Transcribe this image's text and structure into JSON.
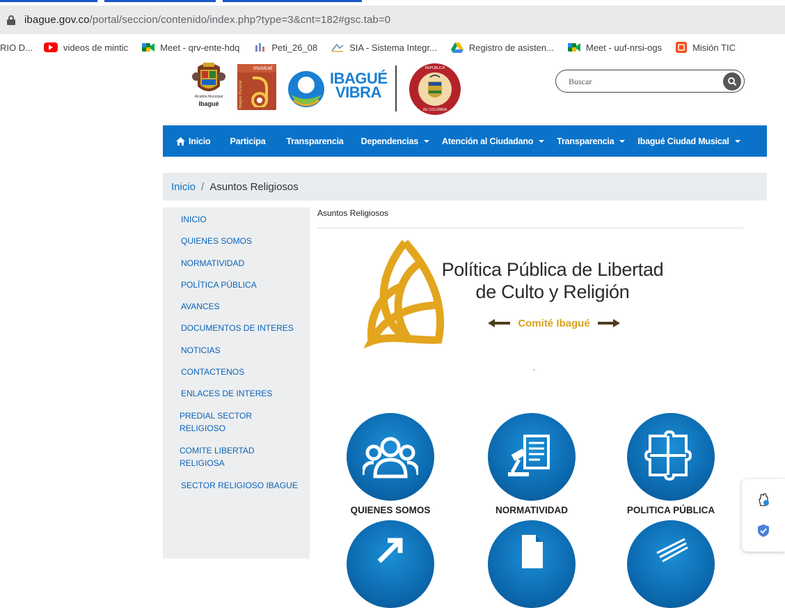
{
  "browser": {
    "url_domain": "ibague.gov.co",
    "url_path": "/portal/seccion/contenido/index.php?type=3&cnt=182#gsc.tab=0",
    "bookmarks": [
      {
        "label": "RIO D...",
        "icon": "none",
        "color": ""
      },
      {
        "label": "videos de mintic",
        "icon": "youtube-icon",
        "color": "#ff0000"
      },
      {
        "label": "Meet - qrv-ente-hdq",
        "icon": "meet-icon",
        "color": "#00832d"
      },
      {
        "label": "Peti_26_08",
        "icon": "doc-icon",
        "color": "#8e7cc3"
      },
      {
        "label": "SIA - Sistema Integr...",
        "icon": "sia-icon",
        "color": "#7aa0c4"
      },
      {
        "label": "Registro de asisten...",
        "icon": "drive-icon",
        "color": "#fbbc04"
      },
      {
        "label": "Meet - uuf-nrsi-ogs",
        "icon": "meet-icon",
        "color": "#00832d"
      },
      {
        "label": "Misión TIC",
        "icon": "mision-icon",
        "color": "#f4511e"
      }
    ]
  },
  "header": {
    "logo1_text1": "Alcaldía Municipal",
    "logo1_text2": "Ibagué",
    "logo2_text1": "musical",
    "logo2_text2": "Ibagué musical",
    "logo3_line1": "IBAGUÉ",
    "logo3_line2": "VIBRA",
    "seal_top": "REPÚBLICA",
    "seal_bottom": "DE COLOMBIA",
    "search_placeholder": "Buscar"
  },
  "nav": {
    "items": [
      {
        "label": "Inicio",
        "dropdown": false
      },
      {
        "label": "Participa",
        "dropdown": false
      },
      {
        "label": "Transparencia",
        "dropdown": false
      },
      {
        "label": "Dependencias",
        "dropdown": true
      },
      {
        "label": "Atención al Ciudadano",
        "dropdown": true
      },
      {
        "label": "Transparencia",
        "dropdown": true
      },
      {
        "label": "Ibagué Ciudad Musical",
        "dropdown": true
      }
    ]
  },
  "breadcrumb": {
    "home": "Inicio",
    "separator": "/",
    "current": "Asuntos Religiosos"
  },
  "sidebar": {
    "items": [
      "INICIO",
      "QUIENES SOMOS",
      "NORMATIVIDAD",
      "POLÍTICA PÚBLICA",
      "AVANCES",
      "DOCUMENTOS DE INTERES",
      "NOTICIAS",
      "CONTACTENOS",
      "ENLACES DE INTERES",
      "PREDIAL SECTOR RELIGIOSO",
      "COMITE LIBERTAD RELIGIOSA",
      "SECTOR RELIGIOSO IBAGUE"
    ]
  },
  "content": {
    "title": "Asuntos Religiosos",
    "banner_line1": "Política Pública de Libertad",
    "banner_line2": "de Culto y Religión",
    "banner_sub": "Comité Ibagué",
    "tiles": [
      {
        "label": "QUIENES SOMOS",
        "icon": "people-icon"
      },
      {
        "label": "NORMATIVIDAD",
        "icon": "gavel-document-icon"
      },
      {
        "label": "POLITICA PÚBLICA",
        "icon": "puzzle-icon"
      }
    ]
  },
  "colors": {
    "nav_blue": "#0a73c9",
    "link_blue": "#0a62b8",
    "gold": "#d9a31f",
    "circle_blue": "#0c6ab0"
  }
}
